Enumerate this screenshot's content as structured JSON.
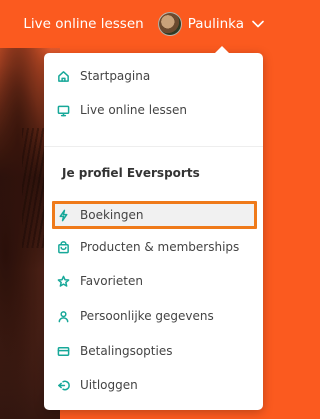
{
  "header": {
    "live_link": "Live online lessen",
    "user_name": "Paulinka"
  },
  "menu": {
    "top_items": [
      {
        "label": "Startpagina",
        "icon": "home-icon"
      },
      {
        "label": "Live online lessen",
        "icon": "monitor-icon"
      }
    ],
    "section_title": "Je profiel Eversports",
    "profile_items": [
      {
        "label": "Boekingen",
        "icon": "lightning-icon",
        "highlighted": true
      },
      {
        "label": "Producten & memberships",
        "icon": "bag-icon"
      },
      {
        "label": "Favorieten",
        "icon": "star-icon"
      },
      {
        "label": "Persoonlijke gegevens",
        "icon": "user-icon"
      },
      {
        "label": "Betalingsopties",
        "icon": "credit-card-icon"
      },
      {
        "label": "Uitloggen",
        "icon": "logout-icon"
      }
    ]
  },
  "colors": {
    "brand_orange": "#fb5a1f",
    "icon_teal": "#17a899",
    "highlight_border": "#ef7a1a"
  }
}
